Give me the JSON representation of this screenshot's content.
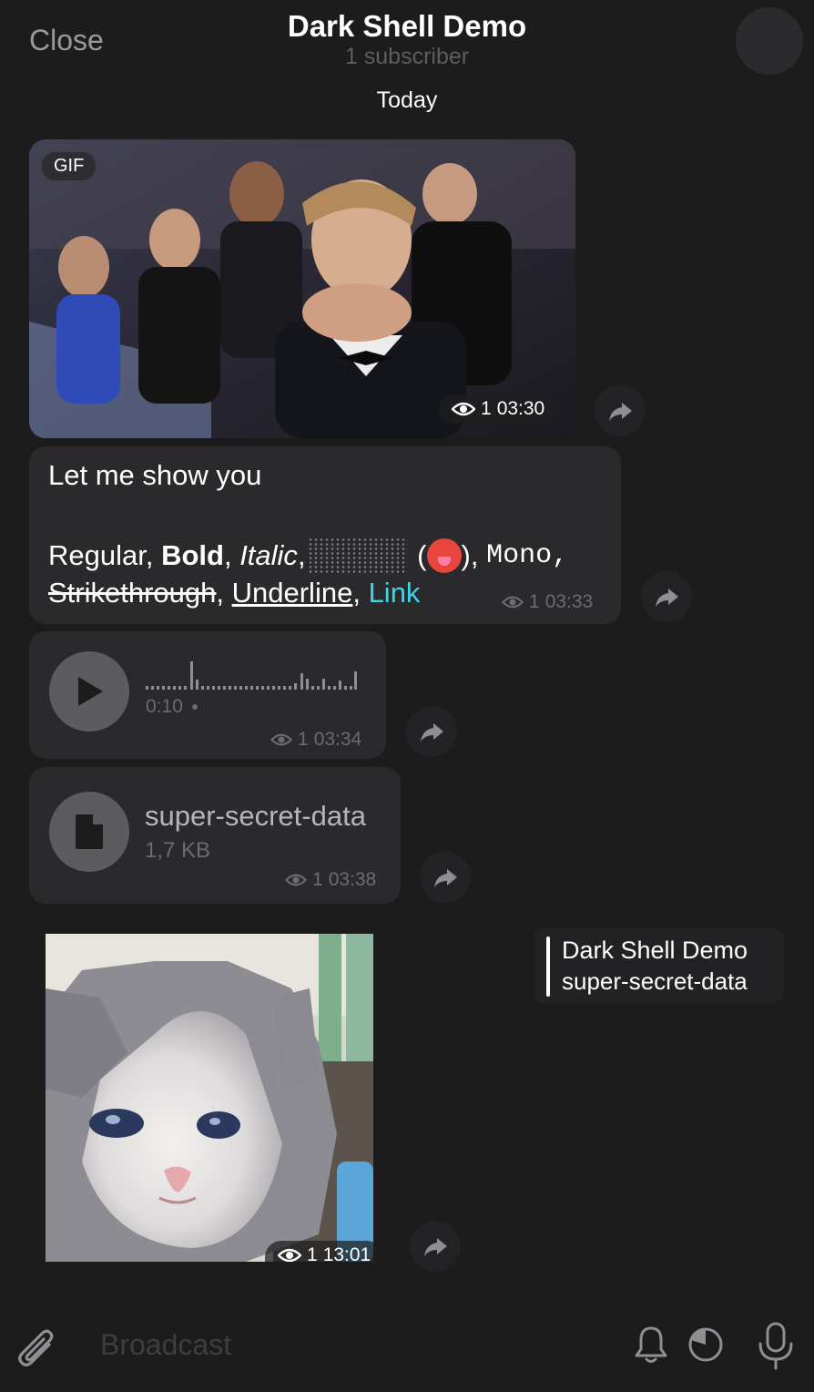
{
  "header": {
    "close_label": "Close",
    "title": "Dark Shell Demo",
    "subtitle": "1 subscriber",
    "date_chip": "Today"
  },
  "messages": {
    "gif": {
      "badge": "GIF",
      "views": "1",
      "time": "03:30"
    },
    "text": {
      "line1": "Let me show you",
      "regular": "Regular, ",
      "bold": "Bold",
      "comma1": ", ",
      "italic": "Italic",
      "comma2": ",",
      "paren_open": " (",
      "paren_close": "), ",
      "mono": "Mono",
      "comma3": ",",
      "strike": "Strikethrough",
      "comma4": ", ",
      "underline": "Underline",
      "comma5": ", ",
      "link": "Link",
      "views": "1",
      "time": "03:33"
    },
    "voice": {
      "duration": "0:10",
      "views": "1",
      "time": "03:34"
    },
    "file": {
      "name": "super-secret-data",
      "size": "1,7 KB",
      "views": "1",
      "time": "03:38"
    },
    "photo": {
      "views": "1",
      "time": "13:01",
      "reply_title": "Dark Shell Demo",
      "reply_text": "super-secret-data"
    }
  },
  "input": {
    "placeholder": "Broadcast"
  },
  "icons": {
    "share": "share-icon",
    "eye": "eye-icon",
    "play": "play-icon",
    "file": "file-icon",
    "attach": "paperclip-icon",
    "bell": "bell-icon",
    "timer": "timer-icon",
    "mic": "microphone-icon"
  },
  "colors": {
    "background": "#1c1c1d",
    "bubble": "#2a2a2c",
    "link": "#3ad6e8",
    "muted": "#6c6c70"
  }
}
